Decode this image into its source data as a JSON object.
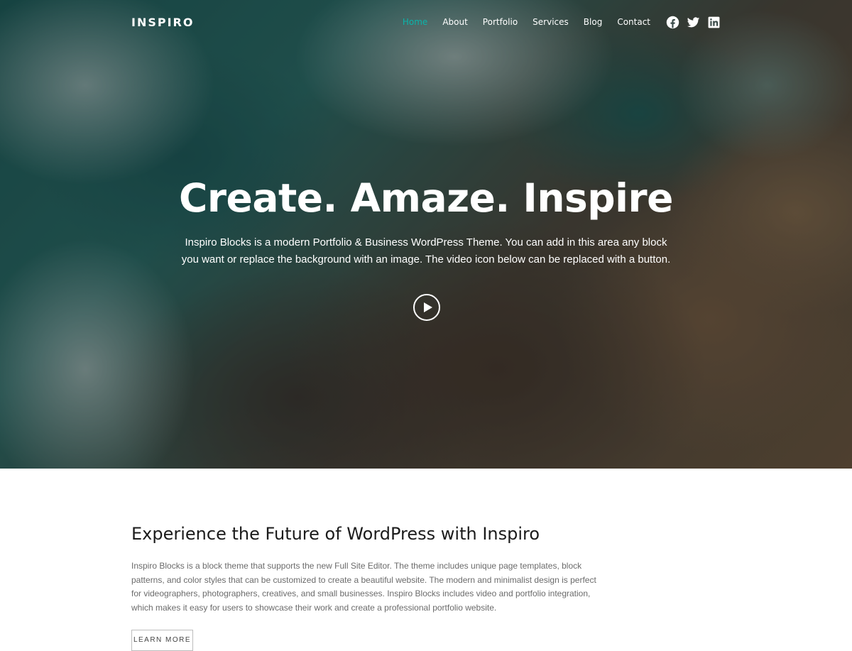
{
  "header": {
    "logo": "INSPIRO",
    "nav": [
      {
        "label": "Home",
        "active": true
      },
      {
        "label": "About",
        "active": false
      },
      {
        "label": "Portfolio",
        "active": false
      },
      {
        "label": "Services",
        "active": false
      },
      {
        "label": "Blog",
        "active": false
      },
      {
        "label": "Contact",
        "active": false
      }
    ],
    "social": [
      "facebook-icon",
      "twitter-icon",
      "linkedin-icon"
    ]
  },
  "hero": {
    "title": "Create. Amaze. Inspire",
    "text": "Inspiro Blocks is a modern Portfolio & Business WordPress Theme. You can add in this area any block you want or replace the background with an image. The video icon below can be replaced with a button.",
    "play_icon": "play-icon"
  },
  "main": {
    "heading": "Experience the Future of WordPress with Inspiro",
    "text": "Inspiro Blocks is a block theme that supports the new Full Site Editor. The theme includes unique page templates, block patterns, and color styles that can be customized to create a beautiful website. The modern and minimalist design is perfect for videographers, photographers, creatives, and small businesses. Inspiro Blocks includes video and portfolio integration, which makes it easy for users to showcase their work and create a professional portfolio website.",
    "button_label": "LEARN MORE"
  },
  "colors": {
    "accent": "#0bb4aa",
    "heading": "#1b1b1b",
    "body_text": "#6b6b6b"
  }
}
